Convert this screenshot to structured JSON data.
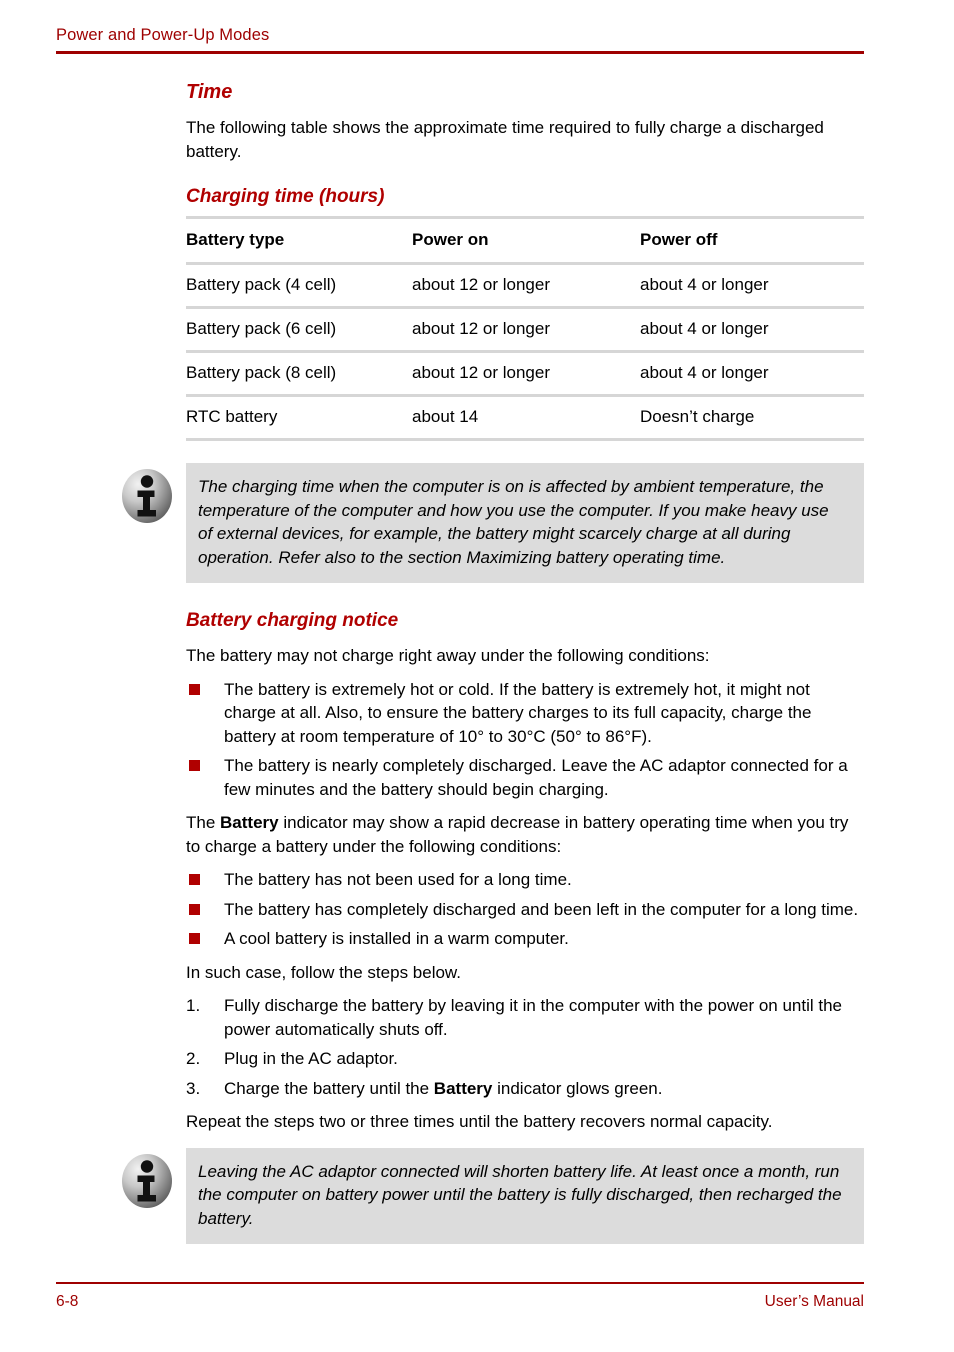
{
  "colors": {
    "accent_red": "#9E0000",
    "heading_red": "#B00000",
    "note_bg": "#DCDCDC",
    "rule_gray": "#D6D6D6"
  },
  "header": {
    "title": "Power and Power-Up Modes"
  },
  "sections": {
    "time": {
      "heading": "Time",
      "intro": "The following table shows the approximate time required to fully charge a discharged battery."
    },
    "charging_time": {
      "heading": "Charging time (hours)"
    },
    "battery_charging_notice": {
      "heading": "Battery charging notice",
      "intro": "The battery may not charge right away under the following conditions:"
    }
  },
  "table": {
    "columns": [
      "Battery type",
      "Power on",
      "Power off"
    ],
    "rows": [
      [
        "Battery pack (4 cell)",
        "about 12 or longer",
        "about 4 or longer"
      ],
      [
        "Battery pack (6 cell)",
        "about 12 or longer",
        "about 4 or longer"
      ],
      [
        "Battery pack (8 cell)",
        "about 12 or longer",
        "about 4 or longer"
      ],
      [
        "RTC battery",
        "about 14",
        "Doesn’t charge"
      ]
    ]
  },
  "note_1": {
    "icon": "info-icon",
    "text": "The charging time when the computer is on is affected by ambient temperature, the temperature of the computer and how you use the computer. If you make heavy use of external devices, for example, the battery might scarcely charge at all during operation. Refer also to the section Maximizing battery operating time."
  },
  "note_2": {
    "icon": "info-icon",
    "text": "Leaving the AC adaptor connected will shorten battery life. At least once a month, run the computer on battery power until the battery is fully discharged, then recharged the battery."
  },
  "bullets_1": [
    "The battery is extremely hot or cold. If the battery is extremely hot, it might not charge at all. Also, to ensure the battery charges to its full capacity, charge the battery at room temperature of 10° to 30°C (50° to 86°F).",
    "The battery is nearly completely discharged. Leave the AC adaptor connected for a few minutes and the battery should begin charging."
  ],
  "indicator_paragraph": {
    "before": "The ",
    "bold": "Battery",
    "after": " indicator may show a rapid decrease in battery operating time when you try to charge a battery under the following conditions:"
  },
  "bullets_2": [
    "The battery has not been used for a long time.",
    "The battery has completely discharged and been left in the computer for a long time.",
    "A cool battery is installed in a warm computer."
  ],
  "steps_intro": "In such case, follow the steps below.",
  "steps": [
    {
      "number": "1.",
      "text": "Fully discharge the battery by leaving it in the computer with the power on until the power automatically shuts off."
    },
    {
      "number": "2.",
      "text": "Plug in the AC adaptor."
    },
    {
      "number": "3.",
      "before": "Charge the battery until the ",
      "bold": "Battery",
      "after": " indicator glows green."
    }
  ],
  "repeat_paragraph": "Repeat the steps two or three times until the battery recovers normal capacity.",
  "footer": {
    "page_number": "6-8",
    "manual_label": "User’s Manual"
  }
}
